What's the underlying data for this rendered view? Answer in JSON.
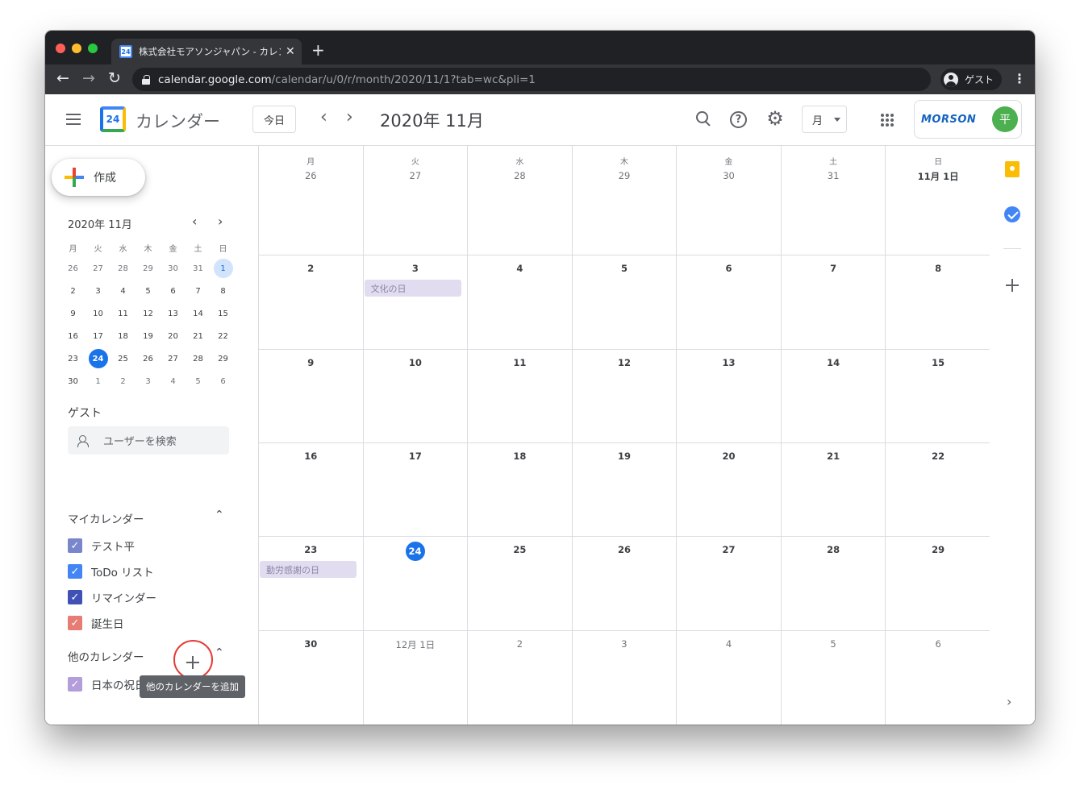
{
  "browser": {
    "tab_title": "株式会社モアソンジャパン - カレンダー",
    "url_host": "calendar.google.com",
    "url_path": "/calendar/u/0/r/month/2020/11/1?tab=wc&pli=1",
    "profile_label": "ゲスト"
  },
  "header": {
    "app_title": "カレンダー",
    "today_label": "今日",
    "month_title": "2020年 11月",
    "view_label": "月",
    "org_logo_text": "MORSON",
    "avatar_initial": "平"
  },
  "sidebar": {
    "create_label": "作成",
    "mini_title": "2020年 11月",
    "weekdays": [
      "月",
      "火",
      "水",
      "木",
      "金",
      "土",
      "日"
    ],
    "mini_rows": [
      [
        "26",
        "27",
        "28",
        "29",
        "30",
        "31",
        "1"
      ],
      [
        "2",
        "3",
        "4",
        "5",
        "6",
        "7",
        "8"
      ],
      [
        "9",
        "10",
        "11",
        "12",
        "13",
        "14",
        "15"
      ],
      [
        "16",
        "17",
        "18",
        "19",
        "20",
        "21",
        "22"
      ],
      [
        "23",
        "24",
        "25",
        "26",
        "27",
        "28",
        "29"
      ],
      [
        "30",
        "1",
        "2",
        "3",
        "4",
        "5",
        "6"
      ]
    ],
    "guest_label": "ゲスト",
    "user_search_placeholder": "ユーザーを検索",
    "my_calendars_label": "マイカレンダー",
    "my_calendars": [
      {
        "label": "テスト平",
        "color": "#7986cb"
      },
      {
        "label": "ToDo リスト",
        "color": "#4285f4"
      },
      {
        "label": "リマインダー",
        "color": "#3f51b5"
      },
      {
        "label": "誕生日",
        "color": "#e67c73"
      }
    ],
    "other_calendars_label": "他のカレンダー",
    "other_calendars": [
      {
        "label": "日本の祝日",
        "color": "#b39ddb"
      }
    ],
    "add_tooltip": "他のカレンダーを追加"
  },
  "grid": {
    "weekdays": [
      "月",
      "火",
      "水",
      "木",
      "金",
      "土",
      "日"
    ],
    "rows": [
      [
        "26",
        "27",
        "28",
        "29",
        "30",
        "31",
        "11月 1日"
      ],
      [
        "2",
        "3",
        "4",
        "5",
        "6",
        "7",
        "8"
      ],
      [
        "9",
        "10",
        "11",
        "12",
        "13",
        "14",
        "15"
      ],
      [
        "16",
        "17",
        "18",
        "19",
        "20",
        "21",
        "22"
      ],
      [
        "23",
        "24",
        "25",
        "26",
        "27",
        "28",
        "29"
      ],
      [
        "30",
        "12月 1日",
        "2",
        "3",
        "4",
        "5",
        "6"
      ]
    ],
    "events": {
      "culture_day": "文化の日",
      "labor_day": "勤労感謝の日"
    }
  },
  "colors": {
    "accent": "#1a73e8",
    "event_bg": "#e1dcf0"
  }
}
